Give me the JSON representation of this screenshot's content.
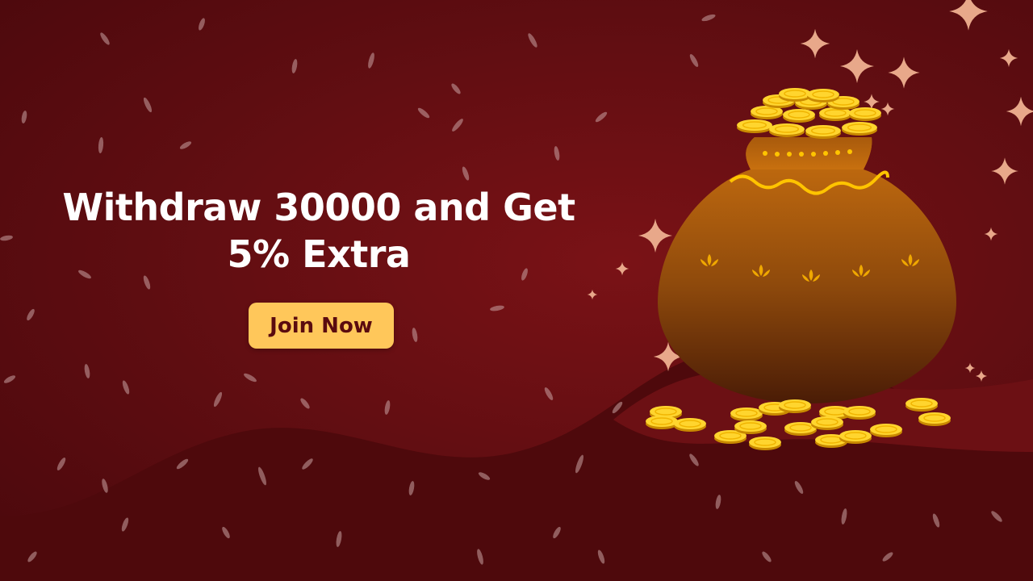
{
  "promo": {
    "headline_line1": "Withdraw 30000 and Get",
    "headline_line2": "5% Extra",
    "cta_label": "Join Now"
  },
  "colors": {
    "background": "#5e0d11",
    "accent": "#ffc75a",
    "coin": "#f5c518",
    "pot": "#b35a0c",
    "text": "#ffffff"
  },
  "illustration": {
    "pot_icon": "pot-of-gold-icon",
    "coin_icon": "gold-coin-icon",
    "sparkle_icon": "sparkle-icon"
  }
}
